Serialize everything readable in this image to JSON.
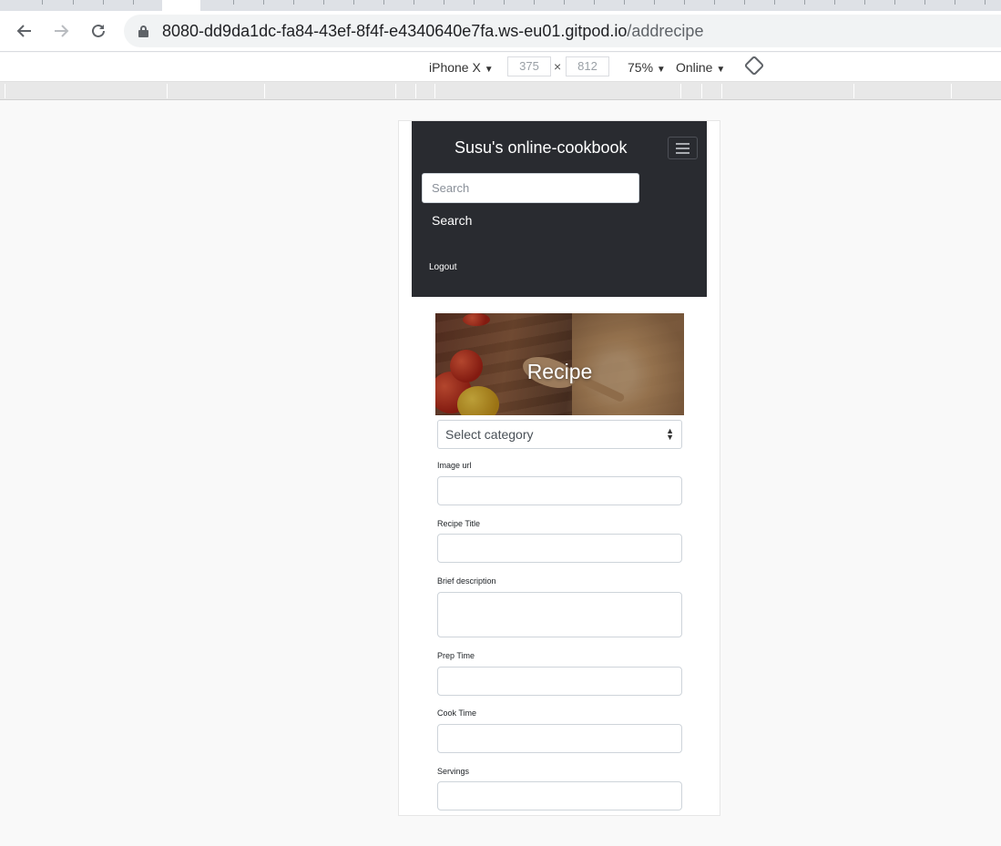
{
  "browser": {
    "url_host": "8080-dd9da1dc-fa84-43ef-8f4f-e4340640e7fa.ws-eu01.gitpod.io",
    "url_path": "/addrecipe",
    "back_icon": "arrow-left-icon",
    "forward_icon": "arrow-right-icon",
    "reload_icon": "reload-icon"
  },
  "device_toolbar": {
    "device": "iPhone X",
    "width": "375",
    "height": "812",
    "zoom": "75%",
    "network": "Online",
    "caret": "▼"
  },
  "navbar": {
    "brand": "Susu's online-cookbook",
    "search_placeholder": "Search",
    "search_button": "Search",
    "logout": "Logout"
  },
  "hero": {
    "title": "Recipe"
  },
  "form": {
    "category_placeholder": "Select category",
    "fields": [
      {
        "label": "Image url"
      },
      {
        "label": "Recipe Title"
      },
      {
        "label": "Brief description"
      },
      {
        "label": "Prep Time"
      },
      {
        "label": "Cook Time"
      },
      {
        "label": "Servings"
      }
    ]
  }
}
